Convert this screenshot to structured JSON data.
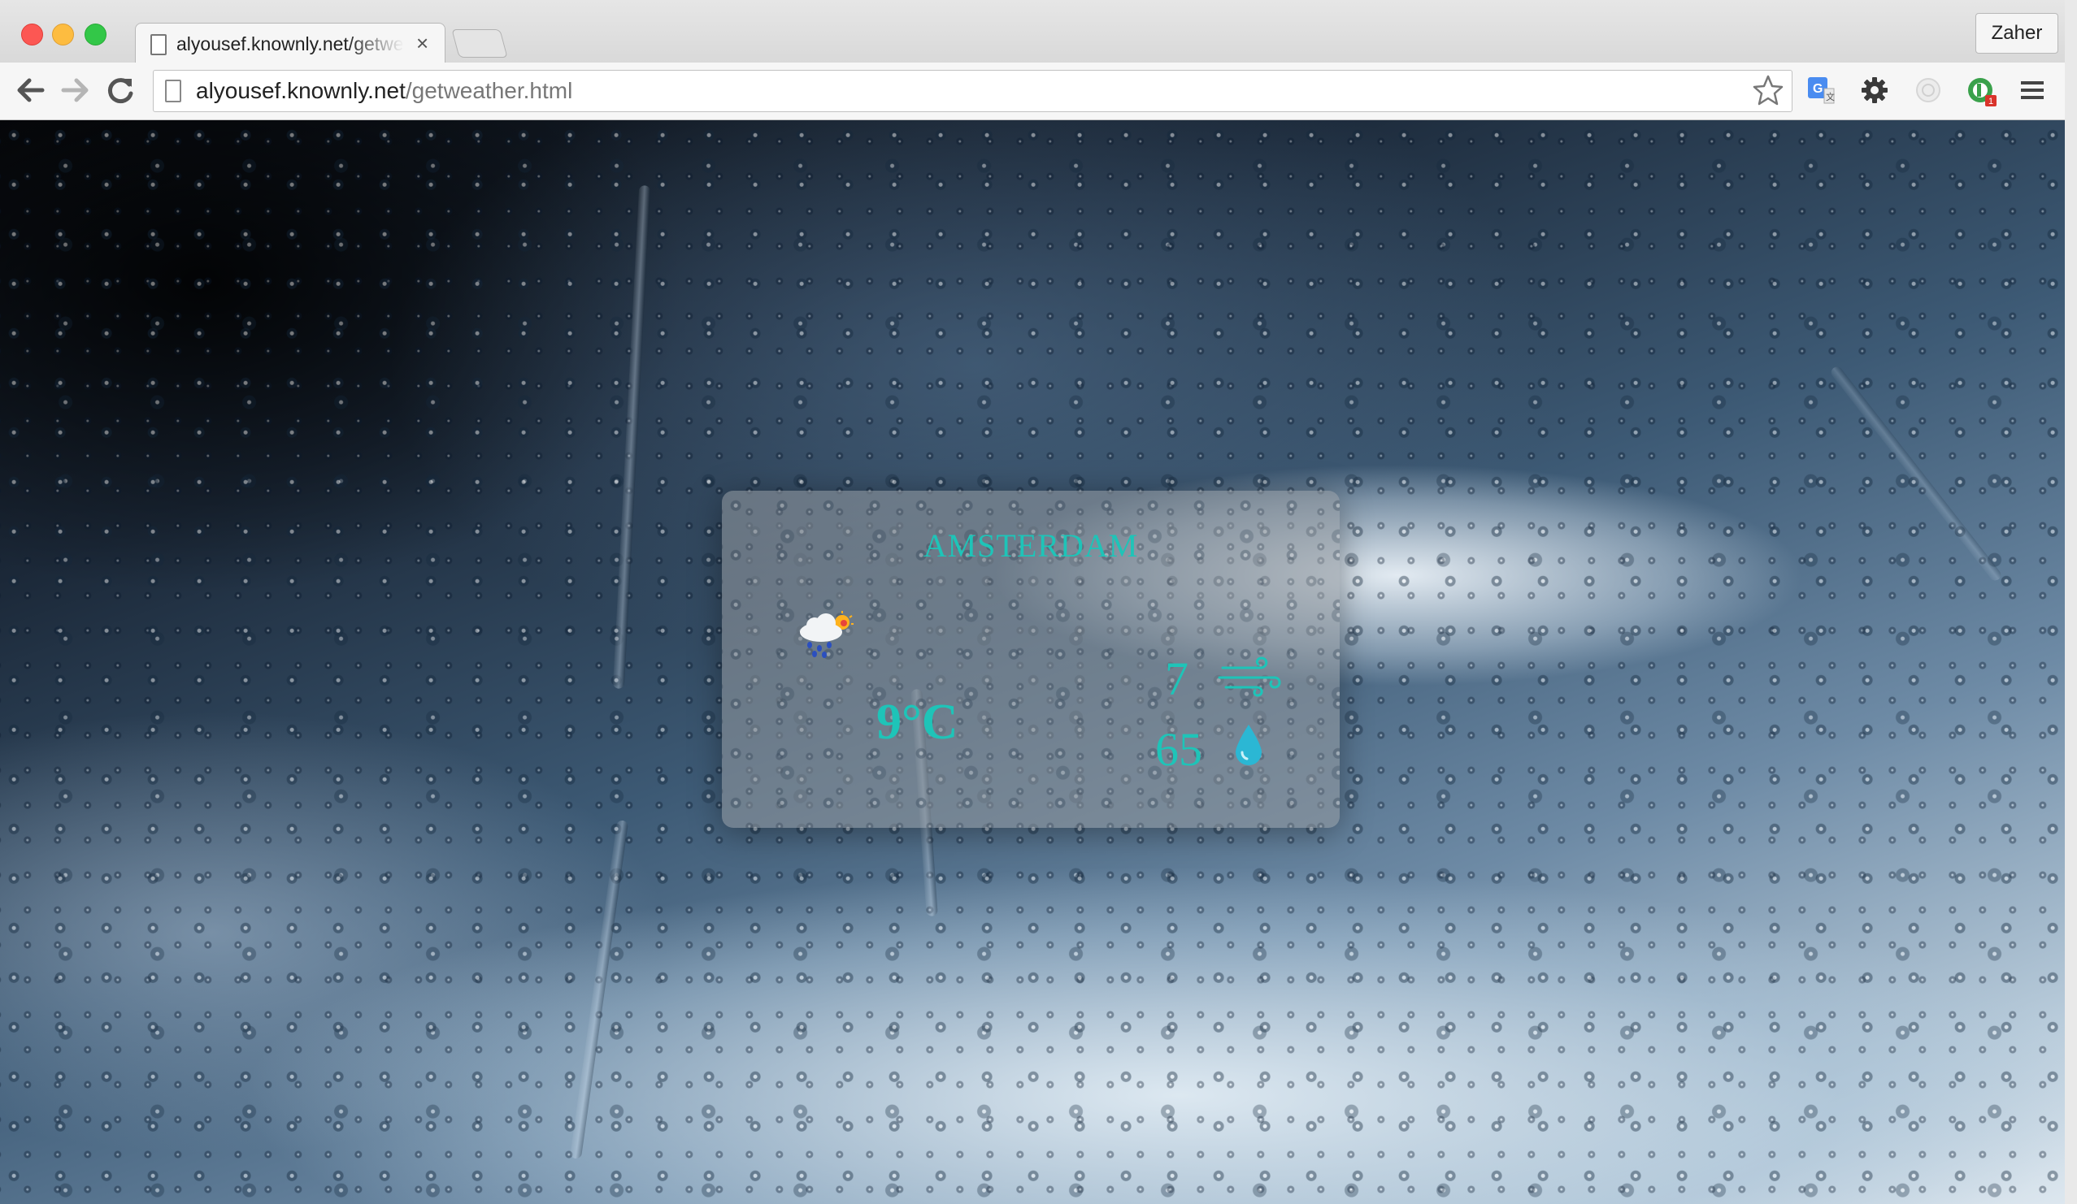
{
  "browser": {
    "tab_title": "alyousef.knownly.net/getweather.html",
    "tab_close": "×",
    "profile_name": "Zaher",
    "url_host": "alyousef.knownly.net",
    "url_path": "/getweather.html",
    "icons": {
      "back": "arrow-left-icon",
      "forward": "arrow-right-icon",
      "reload": "reload-icon",
      "star": "star-icon",
      "translate": "google-translate-icon",
      "settings": "gear-icon",
      "extension": "circle-extension-icon",
      "green_extension": "green-extension-icon",
      "menu": "hamburger-menu-icon"
    }
  },
  "weather": {
    "city": "AMSTERDAM",
    "condition_icon": "rain-cloud-sun-icon",
    "temperature": "9°C",
    "wind": "7",
    "wind_icon": "wind-icon",
    "humidity": "65",
    "humidity_icon": "water-drop-icon",
    "accent_color": "#1ec4b8"
  }
}
